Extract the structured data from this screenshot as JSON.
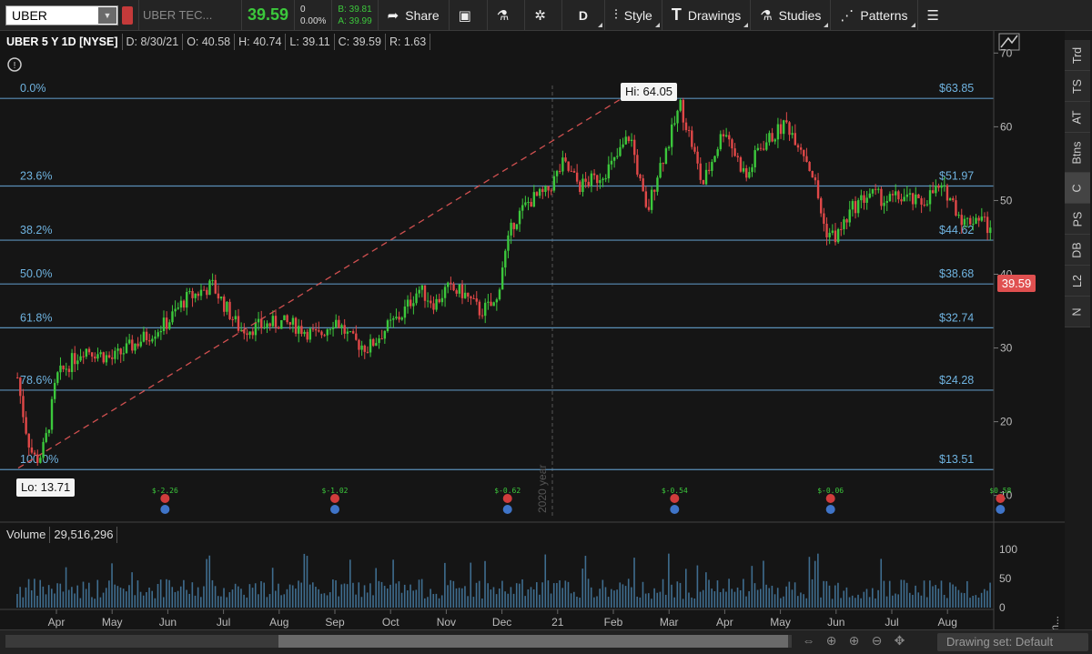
{
  "toolbar": {
    "symbol": "UBER",
    "company": "UBER TEC...",
    "last": "39.59",
    "net_change": "0",
    "net_pct": "0.00%",
    "bid": "B: 39.81",
    "ask": "A: 39.99",
    "share": "Share",
    "period": "D",
    "style": "Style",
    "drawings": "Drawings",
    "studies": "Studies",
    "patterns": "Patterns"
  },
  "header": {
    "title": "UBER 5 Y 1D [NYSE]",
    "date": "D: 8/30/21",
    "open": "O: 40.58",
    "high": "H: 40.74",
    "low": "L: 39.11",
    "close": "C: 39.59",
    "range": "R: 1.63"
  },
  "price_tag": "39.59",
  "hi_label": "Hi: 64.05",
  "lo_label": "Lo: 13.71",
  "year_marker": "2020 year",
  "fib_levels": [
    {
      "pct": "0.0%",
      "price": "$63.85",
      "value": 63.85
    },
    {
      "pct": "23.6%",
      "price": "$51.97",
      "value": 51.97
    },
    {
      "pct": "38.2%",
      "price": "$44.62",
      "value": 44.62
    },
    {
      "pct": "50.0%",
      "price": "$38.68",
      "value": 38.68
    },
    {
      "pct": "61.8%",
      "price": "$32.74",
      "value": 32.74
    },
    {
      "pct": "78.6%",
      "price": "$24.28",
      "value": 24.28
    },
    {
      "pct": "100.0%",
      "price": "$13.51",
      "value": 13.51
    }
  ],
  "earnings": [
    {
      "label": "$-2.26",
      "month_index": 1.95
    },
    {
      "label": "$-1.02",
      "month_index": 5.0
    },
    {
      "label": "$-0.62",
      "month_index": 8.1
    },
    {
      "label": "$-0.54",
      "month_index": 11.1
    },
    {
      "label": "$-0.06",
      "month_index": 13.9
    },
    {
      "label": "$0.58",
      "month_index": 16.95
    }
  ],
  "volume": {
    "label": "Volume",
    "value": "29,516,296",
    "unit": "<million...",
    "ticks": [
      "100",
      "50",
      "0"
    ]
  },
  "side_tabs": [
    "Trd",
    "TS",
    "AT",
    "Btns",
    "C",
    "PS",
    "DB",
    "L2",
    "N"
  ],
  "bottom": {
    "drawing_set": "Drawing set: Default"
  },
  "chart_data": {
    "type": "candlestick",
    "y_ticks": [
      70,
      60,
      50,
      40,
      30,
      20,
      10
    ],
    "ylim": [
      7,
      73
    ],
    "x_tick_labels": [
      "Apr",
      "May",
      "Jun",
      "Jul",
      "Aug",
      "Sep",
      "Oct",
      "Nov",
      "Dec",
      "21",
      "Feb",
      "Mar",
      "Apr",
      "May",
      "Jun",
      "Jul",
      "Aug"
    ],
    "series": [
      {
        "name": "UBER",
        "month_closes": [
          [
            0,
            26.0
          ],
          [
            0.5,
            30.0
          ],
          [
            1.0,
            28.5
          ],
          [
            1.5,
            31.0
          ],
          [
            2.0,
            33.5
          ],
          [
            2.3,
            36.5
          ],
          [
            2.8,
            38.5
          ],
          [
            3.0,
            36.0
          ],
          [
            3.3,
            32.5
          ],
          [
            3.7,
            33.0
          ],
          [
            4.0,
            33.5
          ],
          [
            4.3,
            33.0
          ],
          [
            4.7,
            31.5
          ],
          [
            5.0,
            34.0
          ],
          [
            5.3,
            31.0
          ],
          [
            5.6,
            30.0
          ],
          [
            5.9,
            32.5
          ],
          [
            6.2,
            34.5
          ],
          [
            6.5,
            38.0
          ],
          [
            6.8,
            36.0
          ],
          [
            7.0,
            38.0
          ],
          [
            7.3,
            37.5
          ],
          [
            7.6,
            35.0
          ],
          [
            7.9,
            36.0
          ],
          [
            8.0,
            41.0
          ],
          [
            8.2,
            47.0
          ],
          [
            8.5,
            50.0
          ],
          [
            8.8,
            51.0
          ],
          [
            9.1,
            55.0
          ],
          [
            9.4,
            52.0
          ],
          [
            9.7,
            53.0
          ],
          [
            10.0,
            55.0
          ],
          [
            10.3,
            59.0
          ],
          [
            10.6,
            48.0
          ],
          [
            10.8,
            54.0
          ],
          [
            11.0,
            58.0
          ],
          [
            11.2,
            63.0
          ],
          [
            11.4,
            58.0
          ],
          [
            11.6,
            52.0
          ],
          [
            11.8,
            56.0
          ],
          [
            12.0,
            60.0
          ],
          [
            12.2,
            56.0
          ],
          [
            12.4,
            53.0
          ],
          [
            12.6,
            57.0
          ],
          [
            12.9,
            59.0
          ],
          [
            13.1,
            60.5
          ],
          [
            13.4,
            57.0
          ],
          [
            13.6,
            53.0
          ],
          [
            13.8,
            46.0
          ],
          [
            14.0,
            45.0
          ],
          [
            14.3,
            49.0
          ],
          [
            14.6,
            51.0
          ],
          [
            14.9,
            50.0
          ],
          [
            15.2,
            50.5
          ],
          [
            15.5,
            49.5
          ],
          [
            15.8,
            51.5
          ],
          [
            16.0,
            51.0
          ],
          [
            16.3,
            47.0
          ],
          [
            16.6,
            48.0
          ],
          [
            16.9,
            44.0
          ],
          [
            17.2,
            42.5
          ],
          [
            17.5,
            40.5
          ],
          [
            17.8,
            39.6
          ]
        ]
      }
    ],
    "fib_range": {
      "high": 64.05,
      "low": 13.71
    }
  }
}
